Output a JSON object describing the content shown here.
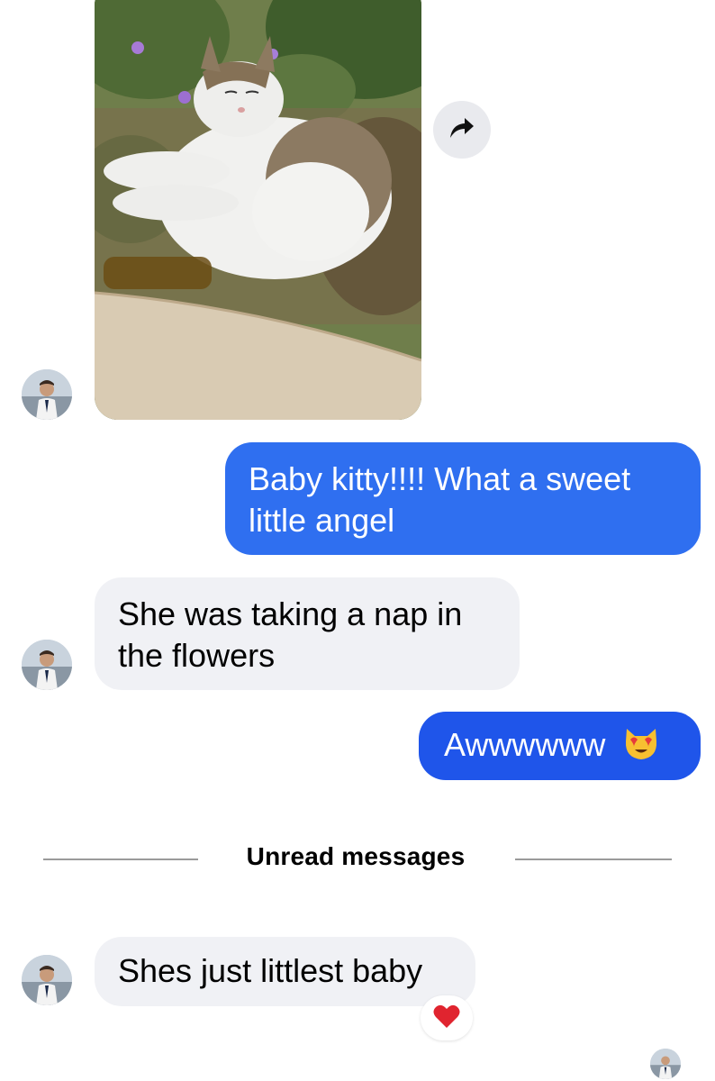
{
  "messages": [
    {
      "sender": "them",
      "type": "photo",
      "description": ""
    },
    {
      "sender": "me",
      "text": "Baby kitty!!!! What a sweet little angel"
    },
    {
      "sender": "them",
      "text": "She was taking a nap in the flowers"
    },
    {
      "sender": "me",
      "text": "Awwwwww",
      "emoji": "smiling-cat-heart-eyes"
    },
    {
      "sender": "them",
      "text": "Shes just littlest baby",
      "reaction": "red-heart"
    }
  ],
  "divider": {
    "label": "Unread messages"
  },
  "icons": {
    "share": "share-arrow-icon",
    "reaction": "red-heart-icon",
    "emoji": "heart-eyes-cat-icon"
  },
  "colors": {
    "outgoing_bubble": "#2f6ff0",
    "outgoing_bubble_alt": "#1f55ea",
    "incoming_bubble": "#f0f1f5",
    "reaction_heart": "#e0242f"
  }
}
